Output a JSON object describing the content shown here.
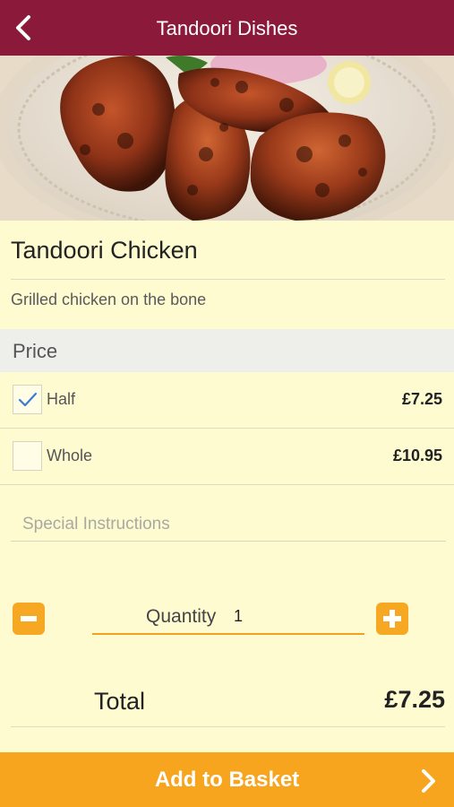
{
  "header": {
    "title": "Tandoori Dishes",
    "back_icon": "chevron-left-icon",
    "bar_color": "#8b1a3a"
  },
  "dish": {
    "name": "Tandoori Chicken",
    "description": "Grilled chicken on the bone"
  },
  "price_section": {
    "heading": "Price",
    "options": [
      {
        "label": "Half",
        "price": "£7.25",
        "checked": true
      },
      {
        "label": "Whole",
        "price": "£10.95",
        "checked": false
      }
    ]
  },
  "instructions": {
    "placeholder": "Special Instructions",
    "value": ""
  },
  "quantity": {
    "label": "Quantity",
    "value": "1",
    "decrease_icon": "minus-icon",
    "increase_icon": "plus-icon"
  },
  "total": {
    "label": "Total",
    "value": "£7.25"
  },
  "basket_button": {
    "label": "Add to Basket",
    "icon": "chevron-right-icon",
    "color": "#f7a41e"
  }
}
